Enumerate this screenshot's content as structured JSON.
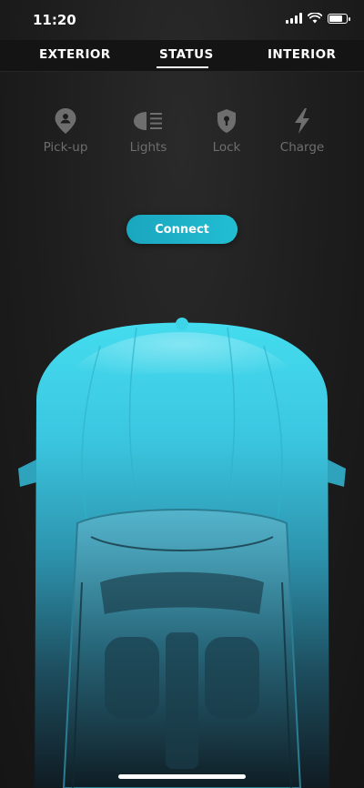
{
  "status_bar": {
    "time": "11:20",
    "battery_level": 0.85
  },
  "tabs": [
    {
      "label": "EXTERIOR",
      "selected": false
    },
    {
      "label": "STATUS",
      "selected": true
    },
    {
      "label": "INTERIOR",
      "selected": false
    }
  ],
  "actions": [
    {
      "label": "Pick-up",
      "icon": "location-pin-person-icon"
    },
    {
      "label": "Lights",
      "icon": "headlight-icon"
    },
    {
      "label": "Lock",
      "icon": "shield-lock-icon"
    },
    {
      "label": "Charge",
      "icon": "lightning-bolt-icon"
    }
  ],
  "connect_button": {
    "label": "Connect"
  },
  "colors": {
    "accent": "#22bdd2",
    "car_top": "#3ed4e8",
    "inactive_icon": "#6e6e6e"
  }
}
